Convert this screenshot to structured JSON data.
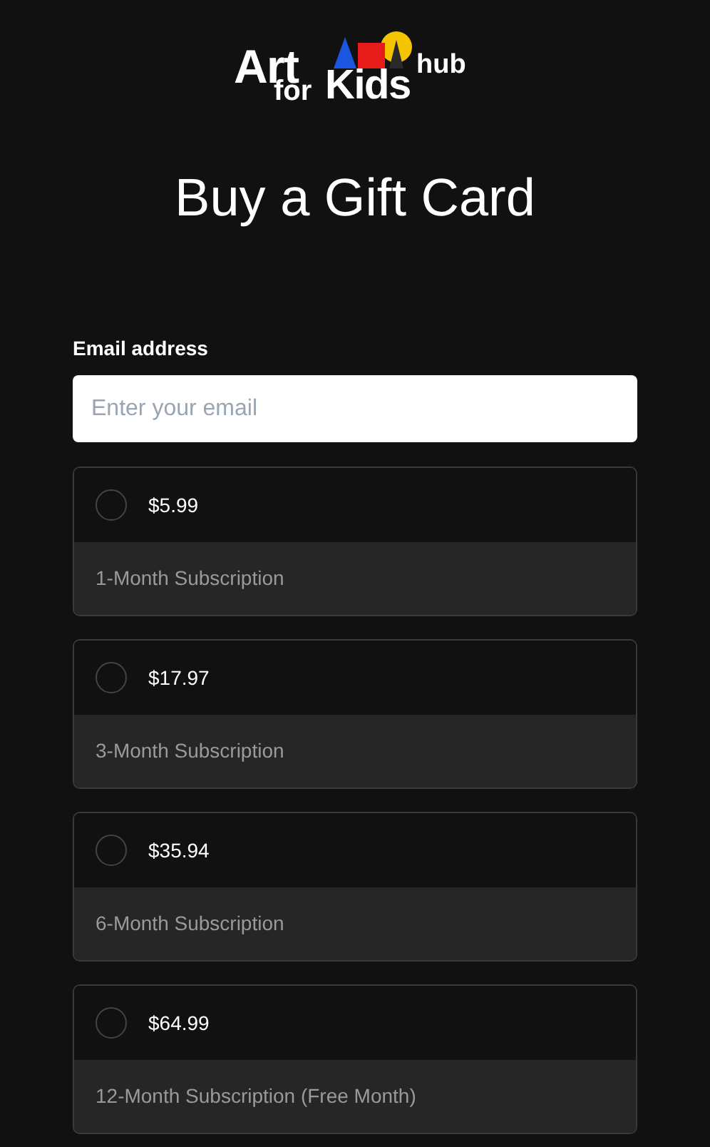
{
  "logo": {
    "words": [
      "Art",
      "for",
      "Kids",
      "hub"
    ]
  },
  "title": "Buy a Gift Card",
  "email": {
    "label": "Email address",
    "placeholder": "Enter your email"
  },
  "options": [
    {
      "price": "$5.99",
      "description": "1-Month Subscription",
      "selected": false
    },
    {
      "price": "$17.97",
      "description": "3-Month Subscription",
      "selected": false
    },
    {
      "price": "$35.94",
      "description": "6-Month Subscription",
      "selected": false
    },
    {
      "price": "$64.99",
      "description": "12-Month Subscription (Free Month)",
      "selected": false
    }
  ]
}
